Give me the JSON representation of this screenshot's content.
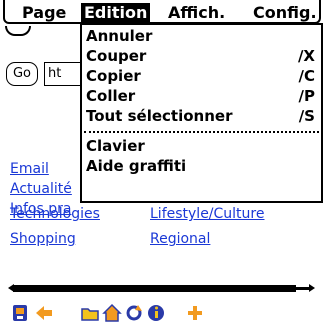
{
  "menubar": {
    "items": [
      {
        "label": "Page"
      },
      {
        "label": "Edition"
      },
      {
        "label": "Affich."
      },
      {
        "label": "Config."
      }
    ]
  },
  "dropdown": {
    "items": [
      {
        "label": "Annuler",
        "shortcut": ""
      },
      {
        "label": "Couper",
        "shortcut": "∕X"
      },
      {
        "label": "Copier",
        "shortcut": "∕C"
      },
      {
        "label": "Coller",
        "shortcut": "∕P"
      },
      {
        "label": "Tout sélectionner",
        "shortcut": "∕S"
      },
      {
        "label": "Clavier",
        "shortcut": ""
      },
      {
        "label": "Aide graffiti",
        "shortcut": ""
      }
    ]
  },
  "browser": {
    "go_label": "Go",
    "url_value": "ht"
  },
  "links": {
    "email": "Email",
    "actualites": "Actualité",
    "infos": "Infos pra",
    "technologies": "Technologies",
    "lifestyle": "Lifestyle/Culture",
    "shopping": "Shopping",
    "regional": "Regional"
  },
  "colors": {
    "link": "#1a38d6",
    "icon_blue": "#2a3aa8",
    "icon_orange": "#f29a1f",
    "icon_yellow": "#f3c21c"
  },
  "toolbar": {
    "icons": [
      "home-device-icon",
      "back-arrow-icon",
      "open-folder-icon",
      "home-icon",
      "refresh-icon",
      "info-icon",
      "plus-icon"
    ]
  }
}
